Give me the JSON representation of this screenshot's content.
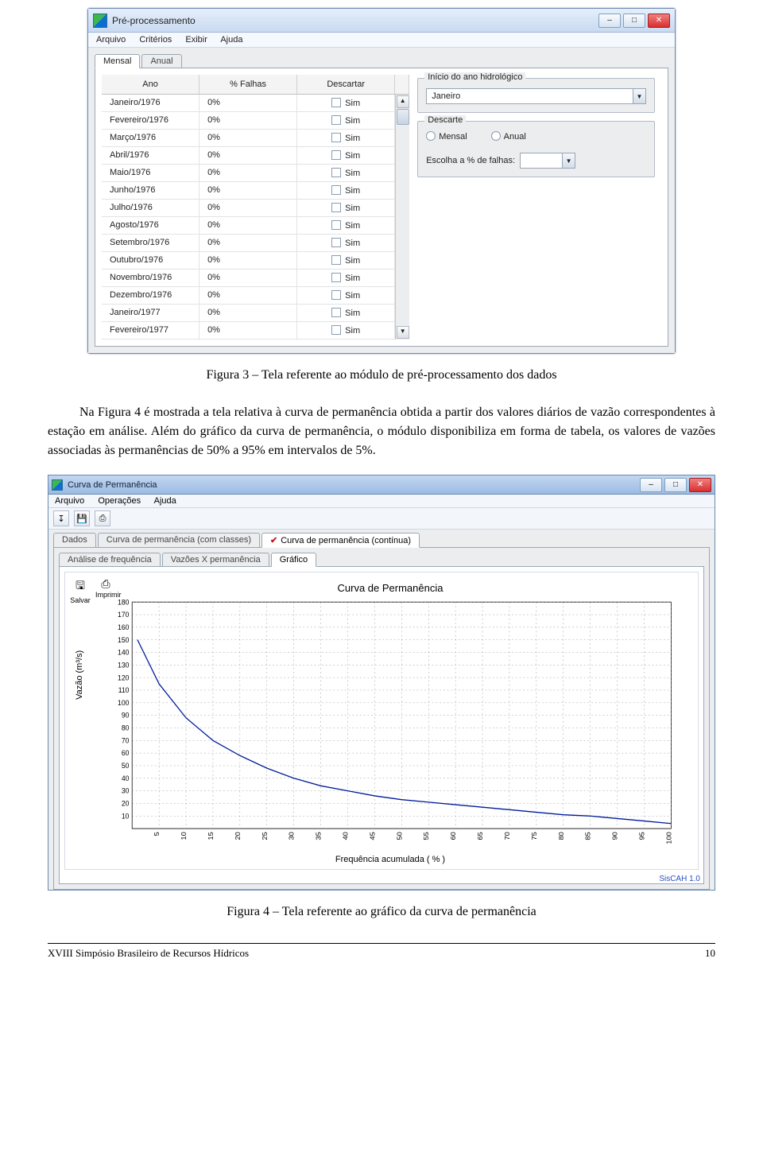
{
  "window1": {
    "title": "Pré-processamento",
    "menus": [
      "Arquivo",
      "Critérios",
      "Exibir",
      "Ajuda"
    ],
    "tabs": {
      "active": "Mensal",
      "inactive": "Anual"
    },
    "columns": {
      "c1": "Ano",
      "c2": "% Falhas",
      "c3": "Descartar"
    },
    "check_label": "Sim",
    "rows": [
      {
        "label": "Janeiro/1976",
        "pct": "0%"
      },
      {
        "label": "Fevereiro/1976",
        "pct": "0%"
      },
      {
        "label": "Março/1976",
        "pct": "0%"
      },
      {
        "label": "Abril/1976",
        "pct": "0%"
      },
      {
        "label": "Maio/1976",
        "pct": "0%"
      },
      {
        "label": "Junho/1976",
        "pct": "0%"
      },
      {
        "label": "Julho/1976",
        "pct": "0%"
      },
      {
        "label": "Agosto/1976",
        "pct": "0%"
      },
      {
        "label": "Setembro/1976",
        "pct": "0%"
      },
      {
        "label": "Outubro/1976",
        "pct": "0%"
      },
      {
        "label": "Novembro/1976",
        "pct": "0%"
      },
      {
        "label": "Dezembro/1976",
        "pct": "0%"
      },
      {
        "label": "Janeiro/1977",
        "pct": "0%"
      },
      {
        "label": "Fevereiro/1977",
        "pct": "0%"
      }
    ],
    "right": {
      "group1_title": "Início do ano hidrológico",
      "group1_value": "Janeiro",
      "group2_title": "Descarte",
      "radio1": "Mensal",
      "radio2": "Anual",
      "pctlabel": "Escolha a % de falhas:",
      "pctvalue": ""
    }
  },
  "caption1": "Figura 3 – Tela referente ao módulo de pré-processamento dos dados",
  "paragraph1": "Na Figura 4 é mostrada a tela relativa à curva de permanência obtida a partir dos valores diários de vazão correspondentes à estação em análise. Além do gráfico da curva de permanência, o módulo disponibiliza em forma de tabela, os valores de vazões associadas às permanências de 50% a 95% em intervalos de 5%.",
  "window2": {
    "title": "Curva de Permanência",
    "menus": [
      "Arquivo",
      "Operações",
      "Ajuda"
    ],
    "outerTabs": {
      "t1": "Dados",
      "t2": "Curva de permanência (com classes)",
      "t3": "Curva de permanência (contínua)"
    },
    "innerTabs": {
      "t1": "Análise de frequência",
      "t2": "Vazões X permanência",
      "t3": "Gráfico"
    },
    "plotToolbar": {
      "save": "Salvar",
      "print": "Imprimir"
    },
    "chart_title": "Curva de Permanência",
    "ylabel": "Vazão (m³/s)",
    "xlabel": "Frequência acumulada ( % )",
    "brand": "SisCAH 1.0"
  },
  "chart_data": {
    "type": "line",
    "title": "Curva de Permanência",
    "xlabel": "Frequência acumulada ( % )",
    "ylabel": "Vazão (m³/s)",
    "ylim": [
      0,
      180
    ],
    "xlim": [
      0,
      100
    ],
    "y_ticks": [
      10,
      20,
      30,
      40,
      50,
      60,
      70,
      80,
      90,
      100,
      110,
      120,
      130,
      140,
      150,
      160,
      170,
      180
    ],
    "x_ticks": [
      5,
      10,
      15,
      20,
      25,
      30,
      35,
      40,
      45,
      50,
      55,
      60,
      65,
      70,
      75,
      80,
      85,
      90,
      95,
      100
    ],
    "series": [
      {
        "name": "Vazão",
        "x": [
          1,
          5,
          10,
          15,
          20,
          25,
          30,
          35,
          40,
          45,
          50,
          55,
          60,
          65,
          70,
          75,
          80,
          85,
          90,
          95,
          100
        ],
        "y": [
          150,
          115,
          88,
          70,
          58,
          48,
          40,
          34,
          30,
          26,
          23,
          21,
          19,
          17,
          15,
          13,
          11,
          10,
          8,
          6,
          4
        ]
      }
    ]
  },
  "caption2": "Figura 4 – Tela referente ao gráfico da curva de permanência",
  "footer": {
    "left": "XVIII Simpósio Brasileiro de Recursos Hídricos",
    "right": "10"
  }
}
